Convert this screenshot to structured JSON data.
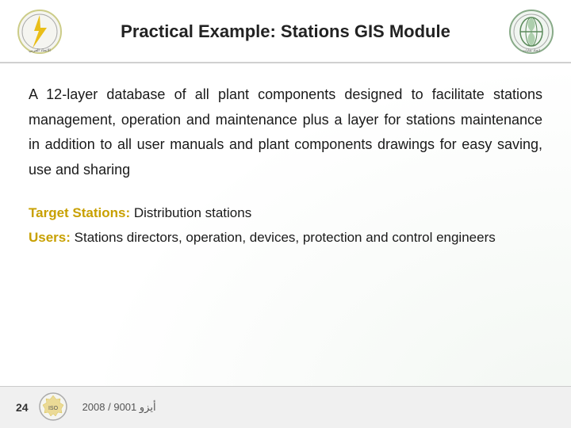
{
  "header": {
    "title": "Practical Example: Stations GIS Module"
  },
  "content": {
    "main_paragraph": "A 12-layer database of all plant components designed to facilitate stations management, operation and maintenance plus a layer for stations maintenance in addition to all user manuals and plant components drawings for easy saving, use and sharing",
    "target_label": "Target Stations:",
    "target_value": " Distribution stations",
    "users_label": "Users:",
    "users_value": " Stations directors, operation, devices, protection and control engineers"
  },
  "footer": {
    "page_number": "24",
    "cert_text": "2008 / 9001 أيزو"
  }
}
